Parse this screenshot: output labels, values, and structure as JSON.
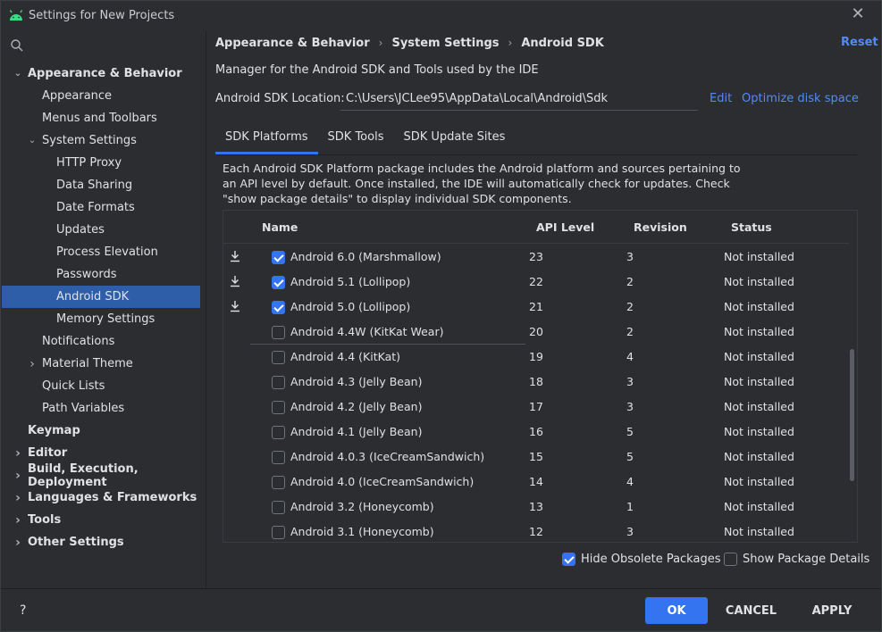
{
  "window": {
    "title": "Settings for New Projects",
    "close_glyph": "✕"
  },
  "tree": [
    {
      "label": "Appearance & Behavior",
      "level": 0,
      "bold": true,
      "caret": "down"
    },
    {
      "label": "Appearance",
      "level": 1
    },
    {
      "label": "Menus and Toolbars",
      "level": 1
    },
    {
      "label": "System Settings",
      "level": 1,
      "caret": "down"
    },
    {
      "label": "HTTP Proxy",
      "level": 2
    },
    {
      "label": "Data Sharing",
      "level": 2
    },
    {
      "label": "Date Formats",
      "level": 2
    },
    {
      "label": "Updates",
      "level": 2
    },
    {
      "label": "Process Elevation",
      "level": 2
    },
    {
      "label": "Passwords",
      "level": 2
    },
    {
      "label": "Android SDK",
      "level": 2,
      "selected": true
    },
    {
      "label": "Memory Settings",
      "level": 2
    },
    {
      "label": "Notifications",
      "level": 1
    },
    {
      "label": "Material Theme",
      "level": 1,
      "caret": "right"
    },
    {
      "label": "Quick Lists",
      "level": 1
    },
    {
      "label": "Path Variables",
      "level": 1
    },
    {
      "label": "Keymap",
      "level": 0,
      "bold": true
    },
    {
      "label": "Editor",
      "level": 0,
      "bold": true,
      "caret": "right"
    },
    {
      "label": "Build, Execution, Deployment",
      "level": 0,
      "bold": true,
      "caret": "right"
    },
    {
      "label": "Languages & Frameworks",
      "level": 0,
      "bold": true,
      "caret": "right"
    },
    {
      "label": "Tools",
      "level": 0,
      "bold": true,
      "caret": "right"
    },
    {
      "label": "Other Settings",
      "level": 0,
      "bold": true,
      "caret": "right"
    }
  ],
  "breadcrumb": {
    "items": [
      "Appearance & Behavior",
      "System Settings",
      "Android SDK"
    ],
    "separator": "›"
  },
  "reset_label": "Reset",
  "description": "Manager for the Android SDK and Tools used by the IDE",
  "sdk_location": {
    "label": "Android SDK Location:",
    "value": "C:\\Users\\JCLee95\\AppData\\Local\\Android\\Sdk",
    "edit_label": "Edit",
    "optimize_label": "Optimize disk space"
  },
  "tabs": [
    {
      "label": "SDK Platforms",
      "active": true
    },
    {
      "label": "SDK Tools"
    },
    {
      "label": "SDK Update Sites"
    }
  ],
  "info_text": "Each Android SDK Platform package includes the Android platform and sources pertaining to an API level by default. Once installed, the IDE will automatically check for updates. Check \"show package details\" to display individual SDK components.",
  "table": {
    "headers": {
      "name": "Name",
      "api": "API Level",
      "revision": "Revision",
      "status": "Status"
    },
    "rows": [
      {
        "name": "Android 6.0 (Marshmallow)",
        "api": "23",
        "revision": "3",
        "status": "Not installed",
        "checked": true,
        "download": true
      },
      {
        "name": "Android 5.1 (Lollipop)",
        "api": "22",
        "revision": "2",
        "status": "Not installed",
        "checked": true,
        "download": true
      },
      {
        "name": "Android 5.0 (Lollipop)",
        "api": "21",
        "revision": "2",
        "status": "Not installed",
        "checked": true,
        "download": true
      },
      {
        "name": "Android 4.4W (KitKat Wear)",
        "api": "20",
        "revision": "2",
        "status": "Not installed",
        "checked": false
      },
      {
        "name": "Android 4.4 (KitKat)",
        "api": "19",
        "revision": "4",
        "status": "Not installed",
        "checked": false
      },
      {
        "name": "Android 4.3 (Jelly Bean)",
        "api": "18",
        "revision": "3",
        "status": "Not installed",
        "checked": false
      },
      {
        "name": "Android 4.2 (Jelly Bean)",
        "api": "17",
        "revision": "3",
        "status": "Not installed",
        "checked": false
      },
      {
        "name": "Android 4.1 (Jelly Bean)",
        "api": "16",
        "revision": "5",
        "status": "Not installed",
        "checked": false
      },
      {
        "name": "Android 4.0.3 (IceCreamSandwich)",
        "api": "15",
        "revision": "5",
        "status": "Not installed",
        "checked": false
      },
      {
        "name": "Android 4.0 (IceCreamSandwich)",
        "api": "14",
        "revision": "4",
        "status": "Not installed",
        "checked": false
      },
      {
        "name": "Android 3.2 (Honeycomb)",
        "api": "13",
        "revision": "1",
        "status": "Not installed",
        "checked": false
      },
      {
        "name": "Android 3.1 (Honeycomb)",
        "api": "12",
        "revision": "3",
        "status": "Not installed",
        "checked": false
      }
    ]
  },
  "options": {
    "hide_obsolete": {
      "label": "Hide Obsolete Packages",
      "checked": true
    },
    "show_details": {
      "label": "Show Package Details",
      "checked": false
    }
  },
  "footer": {
    "help": "?",
    "ok": "OK",
    "cancel": "CANCEL",
    "apply": "APPLY"
  },
  "colors": {
    "accent": "#3574f0",
    "link": "#548af7",
    "selection": "#2e5ea8",
    "background": "#2b2d30"
  },
  "icons": {
    "app": "android-icon",
    "search": "search-icon",
    "download": "download-icon",
    "close": "close-icon"
  }
}
